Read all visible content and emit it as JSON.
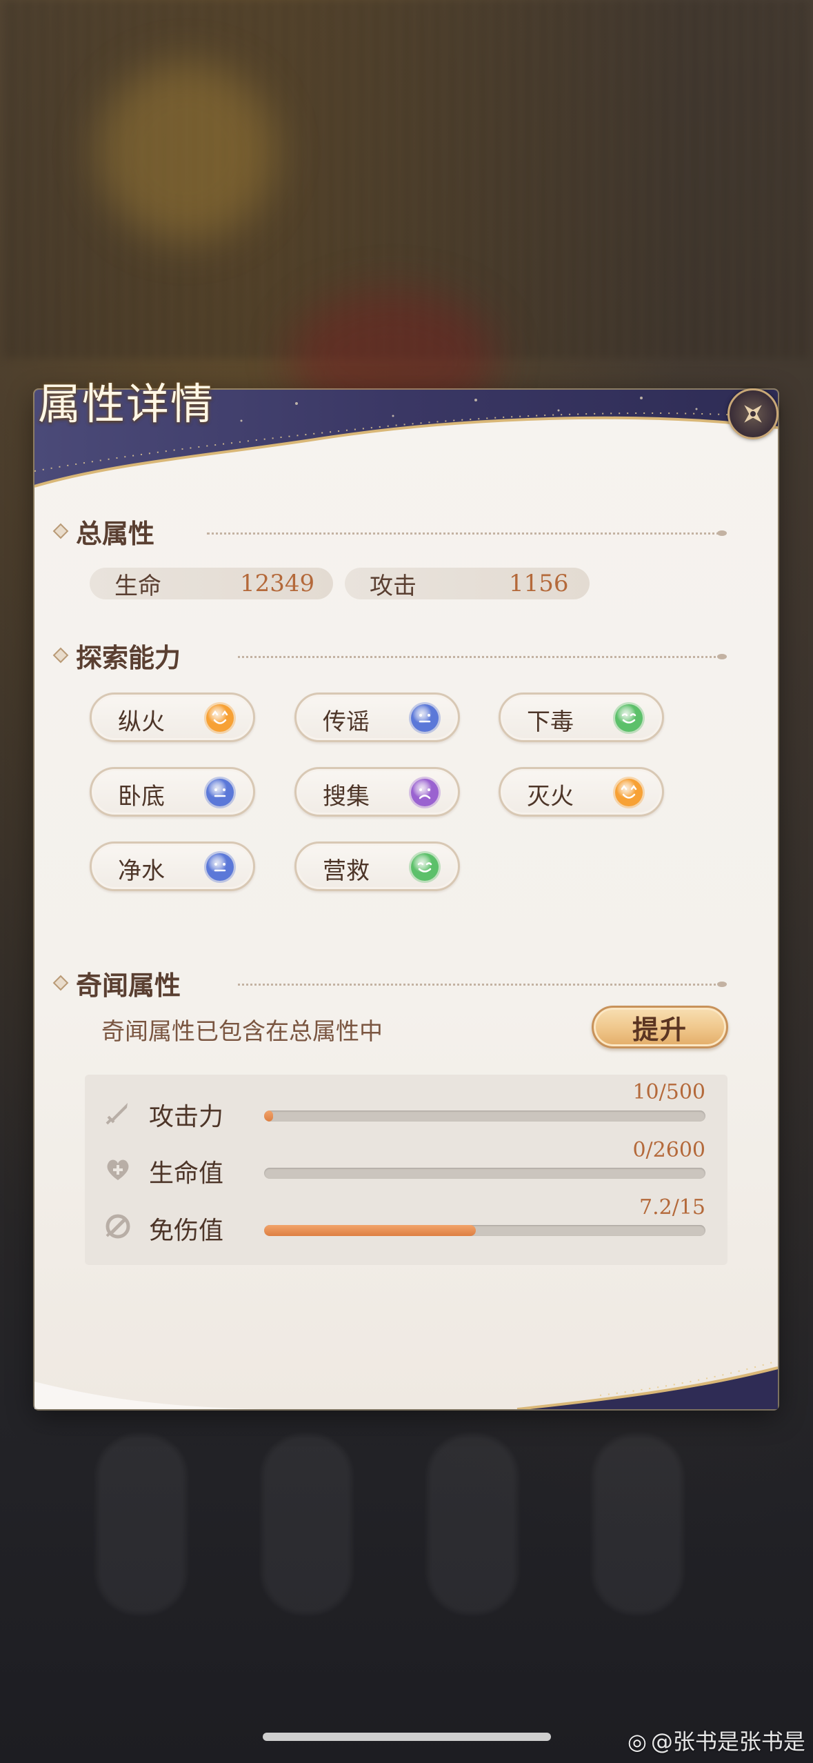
{
  "panel": {
    "title": "属性详情"
  },
  "total": {
    "title": "总属性",
    "stats": [
      {
        "label": "生命",
        "value": "12349"
      },
      {
        "label": "攻击",
        "value": "1156"
      }
    ]
  },
  "explore": {
    "title": "探索能力",
    "abilities": [
      {
        "label": "纵火",
        "mood": "excited",
        "color": "#f7a135"
      },
      {
        "label": "传谣",
        "mood": "neutral",
        "color": "#5b78d8"
      },
      {
        "label": "下毒",
        "mood": "happy",
        "color": "#5cc06a"
      },
      {
        "label": "卧底",
        "mood": "neutral",
        "color": "#5b78d8"
      },
      {
        "label": "搜集",
        "mood": "sad",
        "color": "#9a62d0"
      },
      {
        "label": "灭火",
        "mood": "excited",
        "color": "#f7a135"
      },
      {
        "label": "净水",
        "mood": "neutral",
        "color": "#5b78d8"
      },
      {
        "label": "营救",
        "mood": "happy",
        "color": "#5cc06a"
      }
    ]
  },
  "rumor": {
    "title": "奇闻属性",
    "description": "奇闻属性已包含在总属性中",
    "upgrade_label": "提升",
    "bars": [
      {
        "label": "攻击力",
        "icon": "sword-icon",
        "value": "10/500",
        "fraction": 0.02
      },
      {
        "label": "生命值",
        "icon": "heart-plus-icon",
        "value": "0/2600",
        "fraction": 0
      },
      {
        "label": "免伤值",
        "icon": "shield-block-icon",
        "value": "7.2/15",
        "fraction": 0.48
      }
    ]
  },
  "watermark": {
    "text": "@张书是张书是"
  },
  "colors": {
    "accent": "#b4693a",
    "text": "#4d3528",
    "bar_fill": "#e88a4c"
  }
}
